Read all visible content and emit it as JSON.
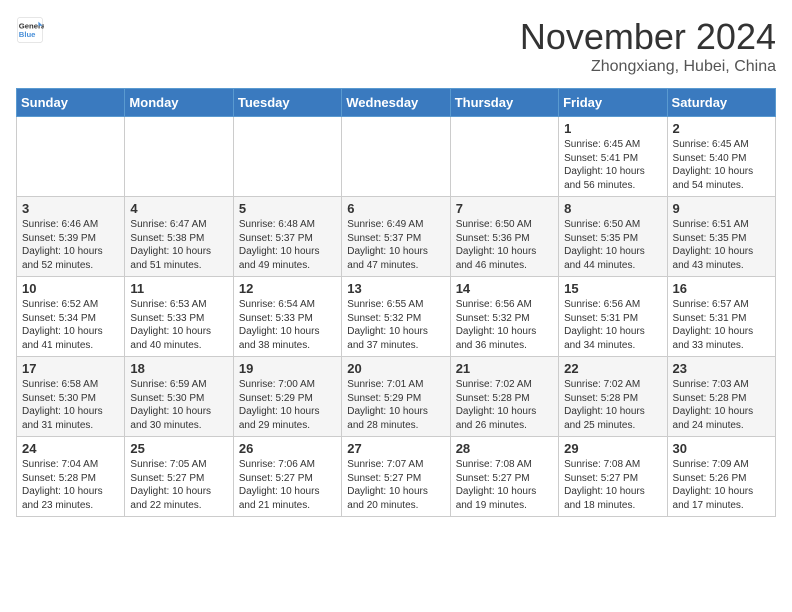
{
  "header": {
    "logo_line1": "General",
    "logo_line2": "Blue",
    "month": "November 2024",
    "location": "Zhongxiang, Hubei, China"
  },
  "weekdays": [
    "Sunday",
    "Monday",
    "Tuesday",
    "Wednesday",
    "Thursday",
    "Friday",
    "Saturday"
  ],
  "weeks": [
    [
      {
        "day": "",
        "info": ""
      },
      {
        "day": "",
        "info": ""
      },
      {
        "day": "",
        "info": ""
      },
      {
        "day": "",
        "info": ""
      },
      {
        "day": "",
        "info": ""
      },
      {
        "day": "1",
        "info": "Sunrise: 6:45 AM\nSunset: 5:41 PM\nDaylight: 10 hours\nand 56 minutes."
      },
      {
        "day": "2",
        "info": "Sunrise: 6:45 AM\nSunset: 5:40 PM\nDaylight: 10 hours\nand 54 minutes."
      }
    ],
    [
      {
        "day": "3",
        "info": "Sunrise: 6:46 AM\nSunset: 5:39 PM\nDaylight: 10 hours\nand 52 minutes."
      },
      {
        "day": "4",
        "info": "Sunrise: 6:47 AM\nSunset: 5:38 PM\nDaylight: 10 hours\nand 51 minutes."
      },
      {
        "day": "5",
        "info": "Sunrise: 6:48 AM\nSunset: 5:37 PM\nDaylight: 10 hours\nand 49 minutes."
      },
      {
        "day": "6",
        "info": "Sunrise: 6:49 AM\nSunset: 5:37 PM\nDaylight: 10 hours\nand 47 minutes."
      },
      {
        "day": "7",
        "info": "Sunrise: 6:50 AM\nSunset: 5:36 PM\nDaylight: 10 hours\nand 46 minutes."
      },
      {
        "day": "8",
        "info": "Sunrise: 6:50 AM\nSunset: 5:35 PM\nDaylight: 10 hours\nand 44 minutes."
      },
      {
        "day": "9",
        "info": "Sunrise: 6:51 AM\nSunset: 5:35 PM\nDaylight: 10 hours\nand 43 minutes."
      }
    ],
    [
      {
        "day": "10",
        "info": "Sunrise: 6:52 AM\nSunset: 5:34 PM\nDaylight: 10 hours\nand 41 minutes."
      },
      {
        "day": "11",
        "info": "Sunrise: 6:53 AM\nSunset: 5:33 PM\nDaylight: 10 hours\nand 40 minutes."
      },
      {
        "day": "12",
        "info": "Sunrise: 6:54 AM\nSunset: 5:33 PM\nDaylight: 10 hours\nand 38 minutes."
      },
      {
        "day": "13",
        "info": "Sunrise: 6:55 AM\nSunset: 5:32 PM\nDaylight: 10 hours\nand 37 minutes."
      },
      {
        "day": "14",
        "info": "Sunrise: 6:56 AM\nSunset: 5:32 PM\nDaylight: 10 hours\nand 36 minutes."
      },
      {
        "day": "15",
        "info": "Sunrise: 6:56 AM\nSunset: 5:31 PM\nDaylight: 10 hours\nand 34 minutes."
      },
      {
        "day": "16",
        "info": "Sunrise: 6:57 AM\nSunset: 5:31 PM\nDaylight: 10 hours\nand 33 minutes."
      }
    ],
    [
      {
        "day": "17",
        "info": "Sunrise: 6:58 AM\nSunset: 5:30 PM\nDaylight: 10 hours\nand 31 minutes."
      },
      {
        "day": "18",
        "info": "Sunrise: 6:59 AM\nSunset: 5:30 PM\nDaylight: 10 hours\nand 30 minutes."
      },
      {
        "day": "19",
        "info": "Sunrise: 7:00 AM\nSunset: 5:29 PM\nDaylight: 10 hours\nand 29 minutes."
      },
      {
        "day": "20",
        "info": "Sunrise: 7:01 AM\nSunset: 5:29 PM\nDaylight: 10 hours\nand 28 minutes."
      },
      {
        "day": "21",
        "info": "Sunrise: 7:02 AM\nSunset: 5:28 PM\nDaylight: 10 hours\nand 26 minutes."
      },
      {
        "day": "22",
        "info": "Sunrise: 7:02 AM\nSunset: 5:28 PM\nDaylight: 10 hours\nand 25 minutes."
      },
      {
        "day": "23",
        "info": "Sunrise: 7:03 AM\nSunset: 5:28 PM\nDaylight: 10 hours\nand 24 minutes."
      }
    ],
    [
      {
        "day": "24",
        "info": "Sunrise: 7:04 AM\nSunset: 5:28 PM\nDaylight: 10 hours\nand 23 minutes."
      },
      {
        "day": "25",
        "info": "Sunrise: 7:05 AM\nSunset: 5:27 PM\nDaylight: 10 hours\nand 22 minutes."
      },
      {
        "day": "26",
        "info": "Sunrise: 7:06 AM\nSunset: 5:27 PM\nDaylight: 10 hours\nand 21 minutes."
      },
      {
        "day": "27",
        "info": "Sunrise: 7:07 AM\nSunset: 5:27 PM\nDaylight: 10 hours\nand 20 minutes."
      },
      {
        "day": "28",
        "info": "Sunrise: 7:08 AM\nSunset: 5:27 PM\nDaylight: 10 hours\nand 19 minutes."
      },
      {
        "day": "29",
        "info": "Sunrise: 7:08 AM\nSunset: 5:27 PM\nDaylight: 10 hours\nand 18 minutes."
      },
      {
        "day": "30",
        "info": "Sunrise: 7:09 AM\nSunset: 5:26 PM\nDaylight: 10 hours\nand 17 minutes."
      }
    ]
  ]
}
